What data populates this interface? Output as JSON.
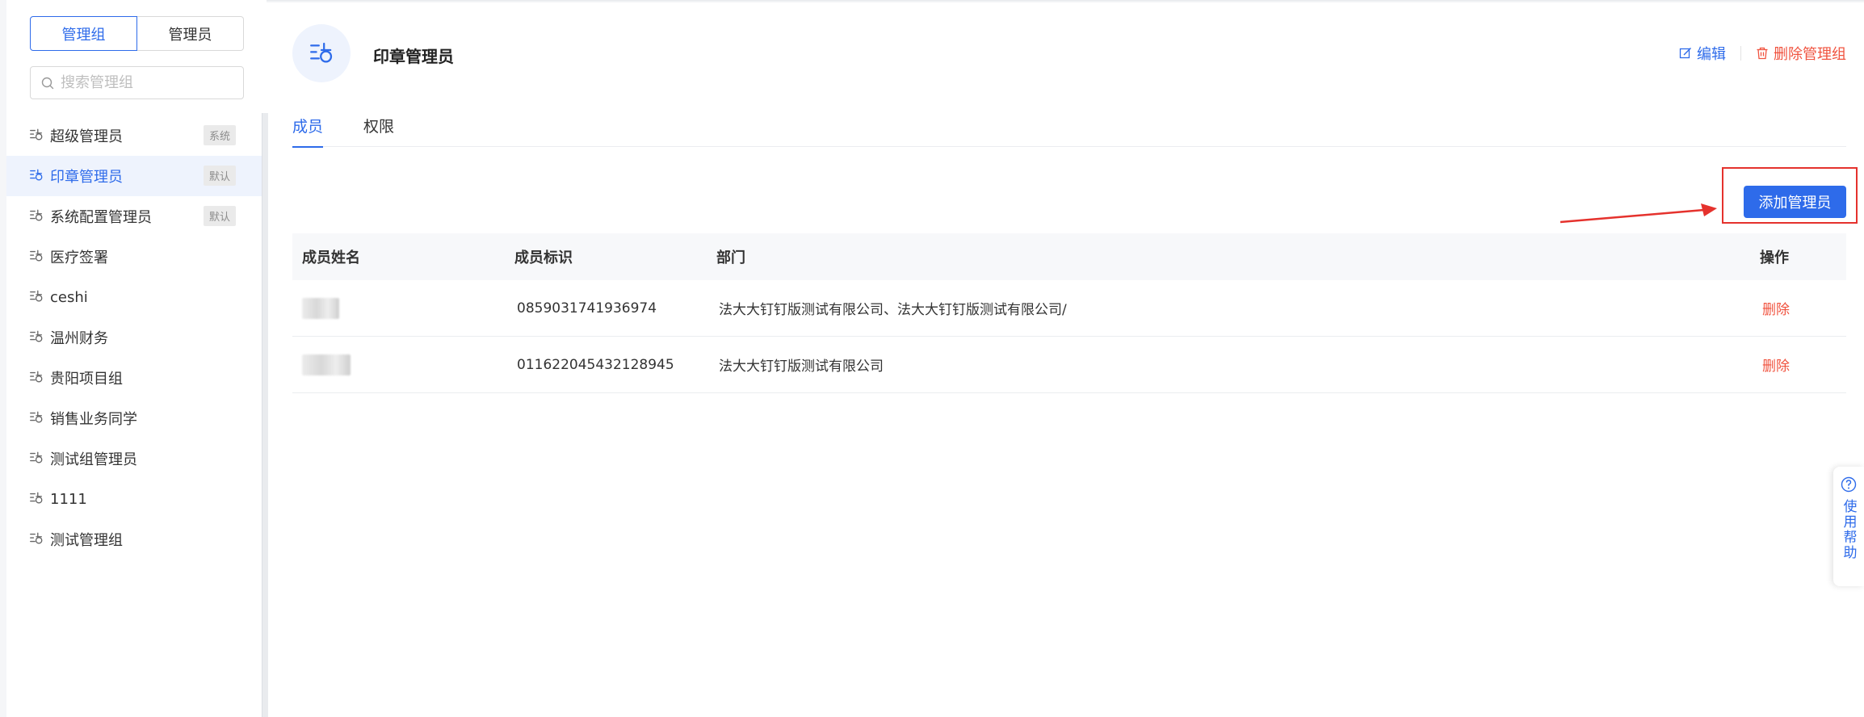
{
  "sidebar": {
    "tabs": [
      "管理组",
      "管理员"
    ],
    "active_tab": 0,
    "search_placeholder": "搜索管理组",
    "groups": [
      {
        "label": "超级管理员",
        "tag": "系统"
      },
      {
        "label": "印章管理员",
        "tag": "默认",
        "active": true
      },
      {
        "label": "系统配置管理员",
        "tag": "默认"
      },
      {
        "label": "医疗签署",
        "tag": ""
      },
      {
        "label": "ceshi",
        "tag": ""
      },
      {
        "label": "温州财务",
        "tag": ""
      },
      {
        "label": "贵阳项目组",
        "tag": ""
      },
      {
        "label": "销售业务同学",
        "tag": ""
      },
      {
        "label": "测试组管理员",
        "tag": ""
      },
      {
        "label": "1111",
        "tag": ""
      },
      {
        "label": "测试管理组",
        "tag": ""
      }
    ]
  },
  "header": {
    "title": "印章管理员",
    "edit_label": "编辑",
    "delete_label": "删除管理组"
  },
  "tabs": [
    "成员",
    "权限"
  ],
  "active_tab": 0,
  "add_button": "添加管理员",
  "table": {
    "columns": [
      "成员姓名",
      "成员标识",
      "部门",
      "操作"
    ],
    "rows": [
      {
        "name": "",
        "id": "0859031741936974",
        "dept": "法大大钉钉版测试有限公司、法大大钉钉版测试有限公司/",
        "action": "删除"
      },
      {
        "name": "",
        "id": "011622045432128945",
        "dept": "法大大钉钉版测试有限公司",
        "action": "删除"
      }
    ]
  },
  "help": {
    "label": "使用帮助"
  },
  "colors": {
    "accent": "#2e6bea",
    "danger": "#f0533f",
    "highlight_box": "#e5322d"
  }
}
